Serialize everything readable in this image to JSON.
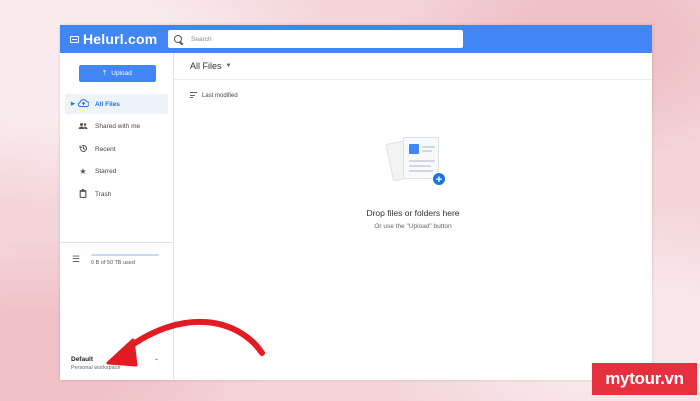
{
  "app": {
    "logo_text": "Helurl.com",
    "brand_color": "#4285f4"
  },
  "search": {
    "placeholder": "Search"
  },
  "sidebar": {
    "upload_label": "Upload",
    "items": [
      {
        "label": "All Files",
        "icon": "cloud-upload-icon",
        "active": true
      },
      {
        "label": "Shared with me",
        "icon": "people-icon",
        "active": false
      },
      {
        "label": "Recent",
        "icon": "history-icon",
        "active": false
      },
      {
        "label": "Starred",
        "icon": "star-icon",
        "active": false
      },
      {
        "label": "Trash",
        "icon": "trash-icon",
        "active": false
      }
    ],
    "storage_text": "0 B of 50 TB used",
    "workspace": {
      "name": "Default",
      "subtitle": "Personal workspace"
    }
  },
  "main": {
    "title": "All Files",
    "sort_label": "Last modified",
    "empty_title": "Drop files or folders here",
    "empty_subtitle": "Or use the \"Upload\" button"
  },
  "watermark": {
    "text": "mytour.vn",
    "color": "#e5313f"
  }
}
